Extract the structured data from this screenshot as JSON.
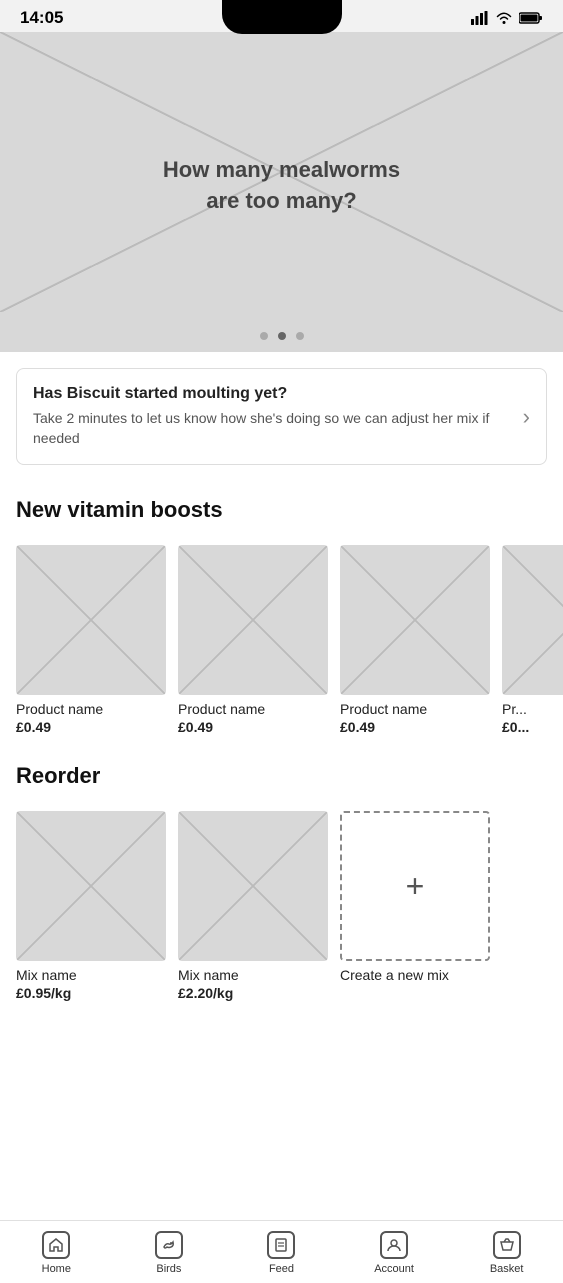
{
  "statusBar": {
    "time": "14:05",
    "icons": [
      "signal",
      "wifi",
      "battery"
    ]
  },
  "heroBanner": {
    "text_line1": "How many mealworms",
    "text_line2": "are too many?",
    "dots": [
      {
        "active": false
      },
      {
        "active": true
      },
      {
        "active": false
      }
    ]
  },
  "notificationCard": {
    "title": "Has Biscuit started moulting yet?",
    "body": "Take 2 minutes to let us know how she's doing so we can adjust her mix if needed",
    "chevron": "›"
  },
  "vitaminsSection": {
    "title": "New vitamin boosts",
    "products": [
      {
        "name": "Product name",
        "price": "£0.49"
      },
      {
        "name": "Product name",
        "price": "£0.49"
      },
      {
        "name": "Product name",
        "price": "£0.49"
      },
      {
        "name": "Pr...",
        "price": "£0..."
      }
    ]
  },
  "reorderSection": {
    "title": "Reorder",
    "mixes": [
      {
        "name": "Mix name",
        "price": "£0.95/kg"
      },
      {
        "name": "Mix name",
        "price": "£2.20/kg"
      }
    ],
    "createNew": {
      "label": "Create a new mix",
      "plus": "+"
    }
  },
  "bottomNav": {
    "items": [
      {
        "label": "Home",
        "icon": "home-icon"
      },
      {
        "label": "Birds",
        "icon": "birds-icon"
      },
      {
        "label": "Feed",
        "icon": "feed-icon"
      },
      {
        "label": "Account",
        "icon": "account-icon"
      },
      {
        "label": "Basket",
        "icon": "basket-icon"
      }
    ]
  }
}
